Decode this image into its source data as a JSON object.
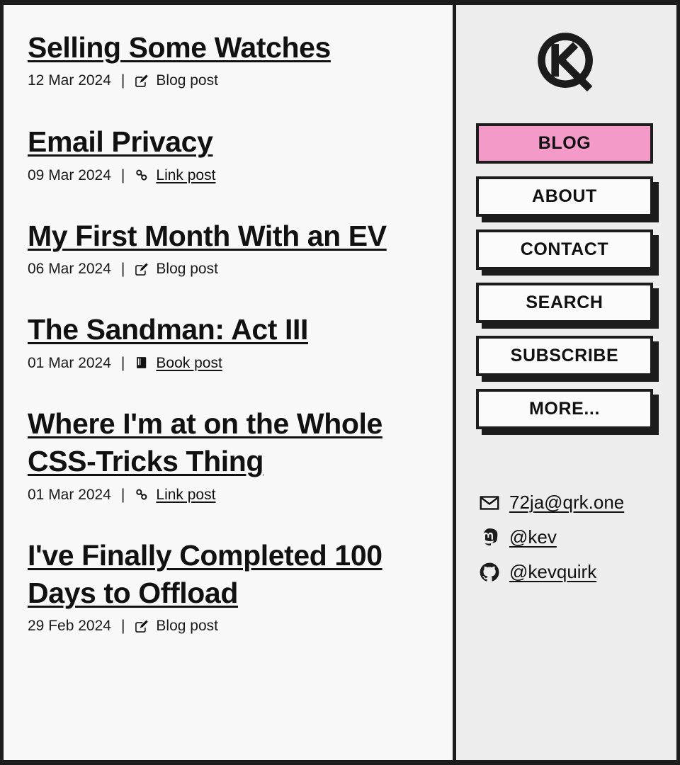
{
  "site": {
    "logo_name": "kq-monogram-logo"
  },
  "main": {
    "posts": [
      {
        "title": "Selling Some Watches",
        "date": "12 Mar 2024",
        "separator": "|",
        "type_label": "Blog post",
        "type_icon": "pencil-square-icon",
        "type_is_link": false
      },
      {
        "title": "Email Privacy",
        "date": "09 Mar 2024",
        "separator": "|",
        "type_label": "Link post",
        "type_icon": "chain-link-icon",
        "type_is_link": true
      },
      {
        "title": "My First Month With an EV",
        "date": "06 Mar 2024",
        "separator": "|",
        "type_label": "Blog post",
        "type_icon": "pencil-square-icon",
        "type_is_link": false
      },
      {
        "title": "The Sandman: Act III",
        "date": "01 Mar 2024",
        "separator": "|",
        "type_label": "Book post",
        "type_icon": "book-icon",
        "type_is_link": true
      },
      {
        "title": "Where I'm at on the Whole CSS-Tricks Thing",
        "date": "01 Mar 2024",
        "separator": "|",
        "type_label": "Link post",
        "type_icon": "chain-link-icon",
        "type_is_link": true
      },
      {
        "title": "I've Finally Completed 100 Days to Offload",
        "date": "29 Feb 2024",
        "separator": "|",
        "type_label": "Blog post",
        "type_icon": "pencil-square-icon",
        "type_is_link": false
      }
    ]
  },
  "sidebar": {
    "nav": [
      {
        "label": "BLOG",
        "active": true
      },
      {
        "label": "ABOUT",
        "active": false
      },
      {
        "label": "CONTACT",
        "active": false
      },
      {
        "label": "SEARCH",
        "active": false
      },
      {
        "label": "SUBSCRIBE",
        "active": false
      },
      {
        "label": "MORE...",
        "active": false
      }
    ],
    "contacts": [
      {
        "label": "72ja@qrk.one",
        "icon": "envelope-icon"
      },
      {
        "label": "@kev",
        "icon": "mastodon-icon"
      },
      {
        "label": "@kevquirk",
        "icon": "github-icon"
      }
    ]
  },
  "colors": {
    "accent_pink": "#f49ac8",
    "ink": "#1c1c1c",
    "main_bg": "#f8f8f8",
    "sidebar_bg": "#ededed"
  }
}
